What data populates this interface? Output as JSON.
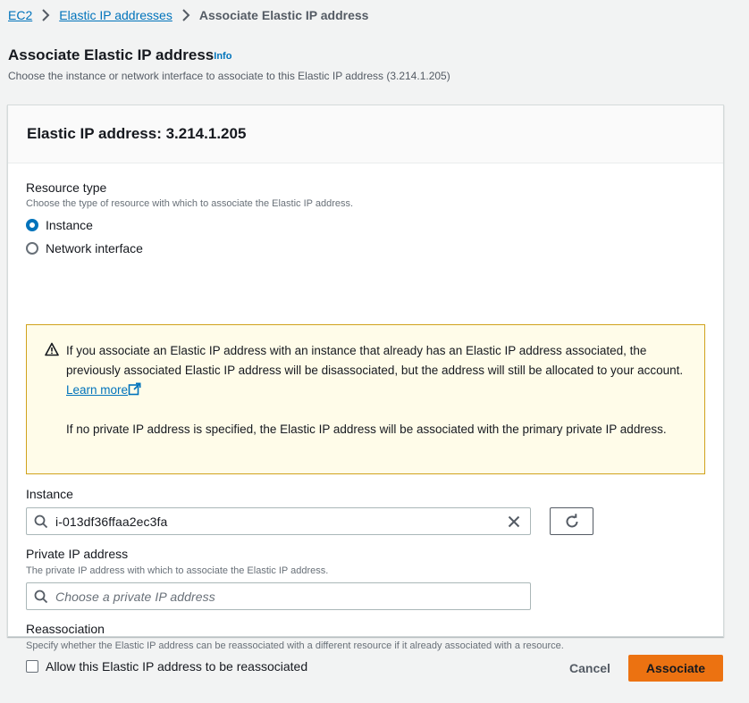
{
  "breadcrumb": {
    "items": [
      "EC2",
      "Elastic IP addresses"
    ],
    "current": "Associate Elastic IP address"
  },
  "header": {
    "title": "Associate Elastic IP address",
    "info": "Info",
    "description": "Choose the instance or network interface to associate to this Elastic IP address (3.214.1.205)"
  },
  "panel": {
    "title": "Elastic IP address: 3.214.1.205",
    "resource_type": {
      "label": "Resource type",
      "description": "Choose the type of resource with which to associate the Elastic IP address.",
      "options": [
        "Instance",
        "Network interface"
      ],
      "selected": "Instance"
    },
    "alert": {
      "paragraph1": "If you associate an Elastic IP address with an instance that already has an Elastic IP address associated, the previously associated Elastic IP address will be disassociated, but the address will still be allocated to your account.",
      "learn_more": "Learn more",
      "paragraph2": "If no private IP address is specified, the Elastic IP address will be associated with the primary private IP address."
    },
    "instance": {
      "label": "Instance",
      "value": "i-013df36ffaa2ec3fa"
    },
    "private_ip": {
      "label": "Private IP address",
      "description": "The private IP address with which to associate the Elastic IP address.",
      "placeholder": "Choose a private IP address"
    },
    "reassociation": {
      "label": "Reassociation",
      "description": "Specify whether the Elastic IP address can be reassociated with a different resource if it already associated with a resource.",
      "checkbox_label": "Allow this Elastic IP address to be reassociated",
      "checked": false
    }
  },
  "footer": {
    "cancel": "Cancel",
    "associate": "Associate"
  },
  "colors": {
    "link": "#0073bb",
    "primary_button": "#ec7211",
    "warning_bg": "#fffce9",
    "warning_border": "#d0a21c"
  }
}
